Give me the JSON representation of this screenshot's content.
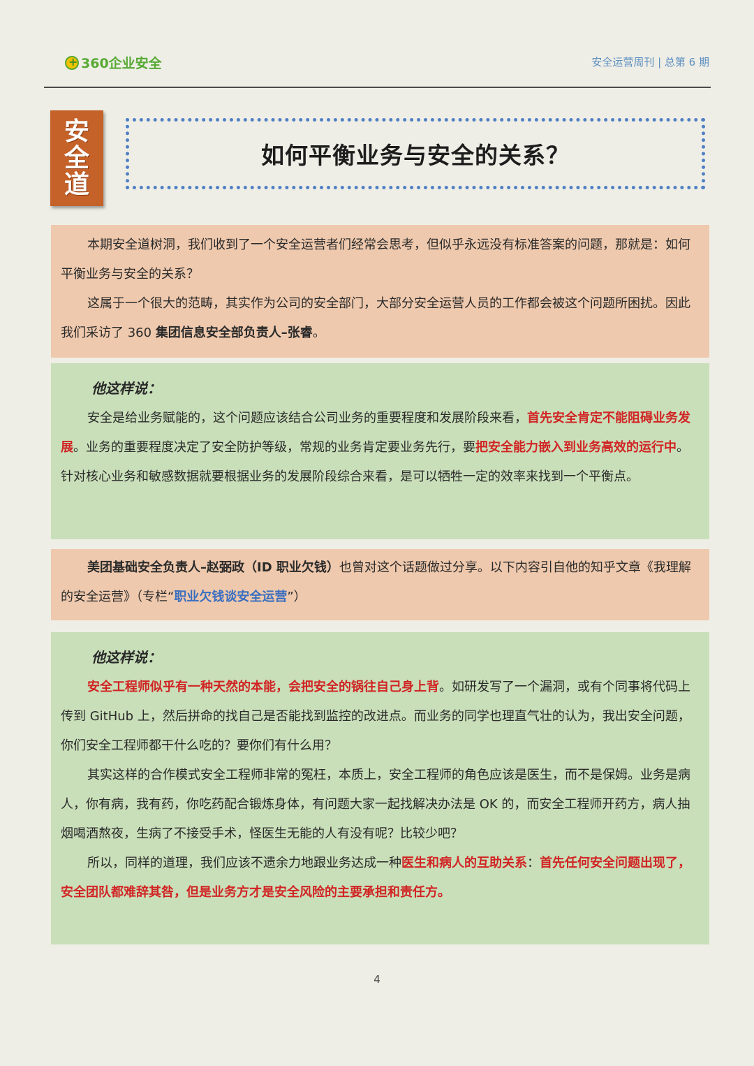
{
  "header": {
    "logo_text": "360企业安全",
    "issue": "安全运营周刊 | 总第 6 期"
  },
  "badge": {
    "chars": [
      "安",
      "全",
      "道"
    ]
  },
  "title": "如何平衡业务与安全的关系？",
  "intro": {
    "p1": "本期安全道树洞，我们收到了一个安全运营者们经常会思考，但似乎永远没有标准答案的问题，那就是：如何平衡业务与安全的关系？",
    "p2_a": "这属于一个很大的范畴，其实作为公司的安全部门，大部分安全运营人员的工作都会被这个问题所困扰。因此我们采访了 360 ",
    "p2_b": "集团信息安全部负责人–张睿",
    "p2_c": "。"
  },
  "quote1": {
    "heading": "他这样说：",
    "t1": "安全是给业务赋能的，这个问题应该结合公司业务的重要程度和发展阶段来看，",
    "h1": "首先安全肯定不能阻碍业务发展",
    "t2": "。业务的重要程度决定了安全防护等级，常规的业务肯定要业务先行，要",
    "h2": "把安全能力嵌入到业务高效的运行中",
    "t3": "。针对核心业务和敏感数据就要根据业务的发展阶段综合来看，是可以牺牲一定的效率来找到一个平衡点。"
  },
  "intro2": {
    "b1": "美团基础安全负责人–赵弼政（ID 职业欠钱）",
    "t1": "也曾对这个话题做过分享。以下内容引自他的知乎文章《我理解的安全运营》（专栏“",
    "link": "职业欠钱谈安全运营",
    "t2": "”）"
  },
  "quote2": {
    "heading": "他这样说：",
    "h1": "安全工程师似乎有一种天然的本能，会把安全的锅往自己身上背",
    "t1": "。如研发写了一个漏洞，或有个同事将代码上传到 GitHub 上，然后拼命的找自己是否能找到监控的改进点。而业务的同学也理直气壮的认为，我出安全问题，你们安全工程师都干什么吃的？要你们有什么用？",
    "p2": "其实这样的合作模式安全工程师非常的冤枉，本质上，安全工程师的角色应该是医生，而不是保姆。业务是病人，你有病，我有药，你吃药配合锻炼身体，有问题大家一起找解决办法是 OK 的，而安全工程师开药方，病人抽烟喝酒熬夜，生病了不接受手术，怪医生无能的人有没有呢？比较少吧？",
    "t3": "所以，同样的道理，我们应该不遗余力地跟业务达成一种",
    "h3": "医生和病人的互助关系",
    "t4": "：",
    "h4": "首先任何安全问题出现了，安全团队都难辞其咎，但是业务方才是安全风险的主要承担和责任方。"
  },
  "page_number": "4"
}
